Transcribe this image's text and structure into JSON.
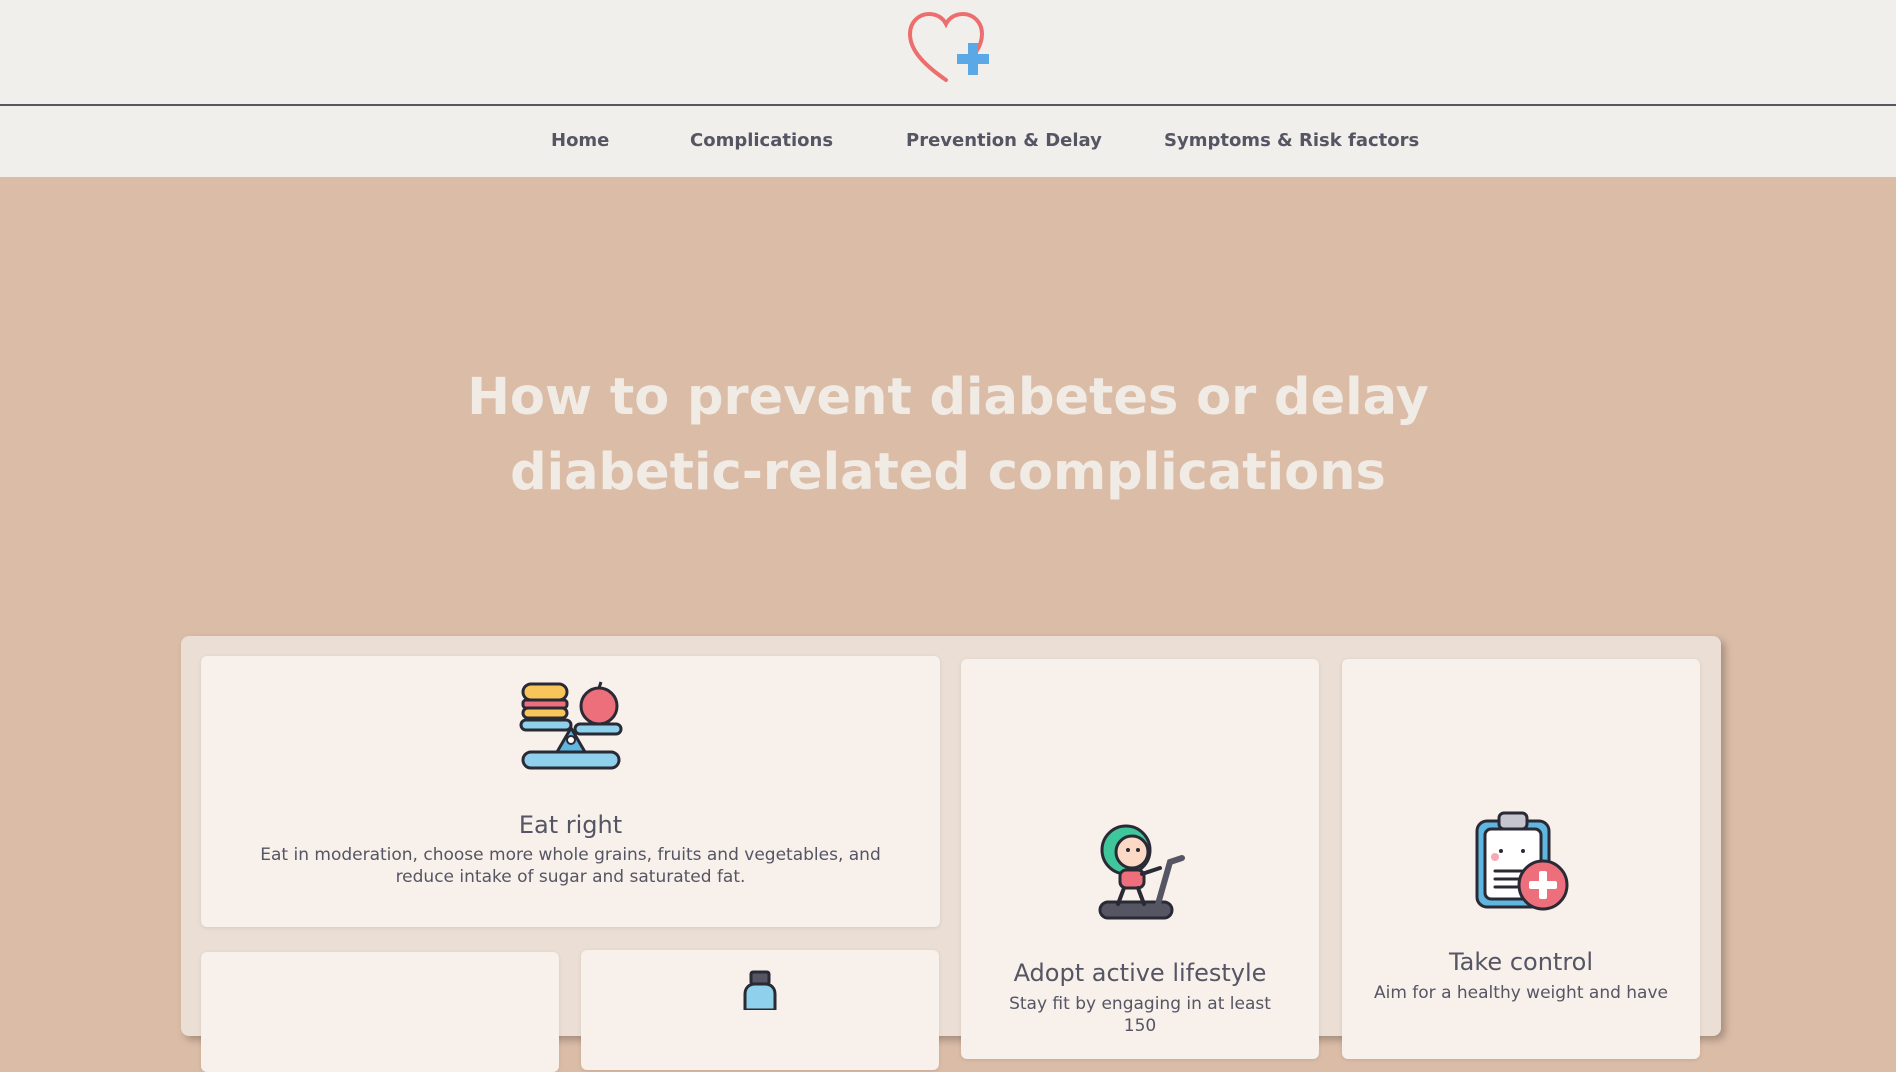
{
  "colors": {
    "header_bg": "#f1efeb",
    "hero_bg": "#dbbca7",
    "panel_bg": "#ebdfd5",
    "card_bg": "#f7f0eb",
    "text": "#555563",
    "hero_text": "#f1ebe5",
    "logo_heart": "#ec6e6e",
    "logo_cross": "#5aa8e6"
  },
  "header": {
    "logo_icon": "heart-plus-logo"
  },
  "nav": {
    "items": [
      {
        "label": "Home"
      },
      {
        "label": "Complications"
      },
      {
        "label": "Prevention & Delay"
      },
      {
        "label": "Symptoms & Risk factors"
      }
    ]
  },
  "hero": {
    "title_line1": "How to prevent diabetes or delay",
    "title_line2": "diabetic-related complications"
  },
  "cards": {
    "eat_right": {
      "icon": "balance-scale-food-icon",
      "title": "Eat right",
      "text": "Eat in moderation, choose more whole grains, fruits and vegetables, and reduce intake of sugar and saturated fat."
    },
    "active_lifestyle": {
      "icon": "treadmill-runner-icon",
      "title": "Adopt active lifestyle",
      "text": "Stay fit by engaging in at least 150"
    },
    "take_control": {
      "icon": "clipboard-medical-icon",
      "title": "Take control",
      "text": "Aim for a healthy weight and have"
    },
    "water": {
      "icon": "water-bottle-icon"
    }
  }
}
